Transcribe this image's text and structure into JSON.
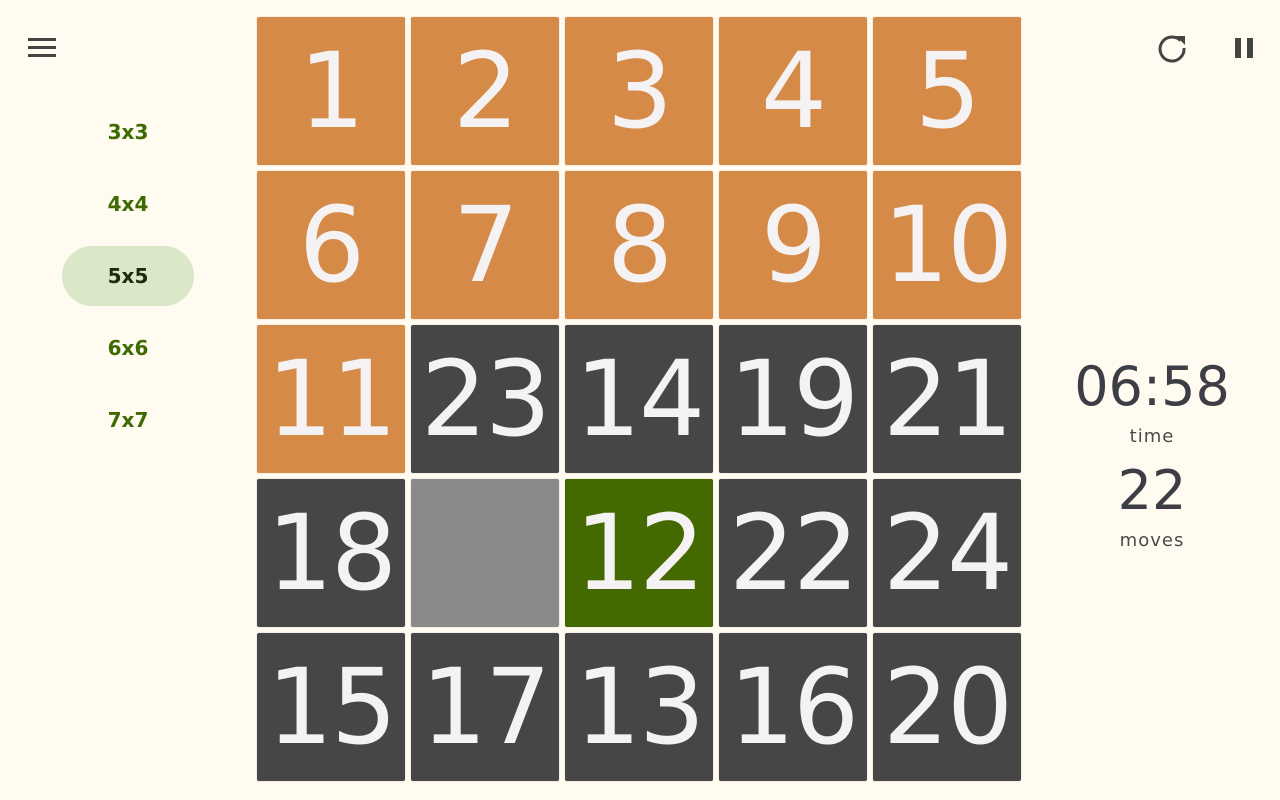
{
  "header": {
    "menu_icon": "menu-icon",
    "restart_icon": "restart-icon",
    "pause_icon": "pause-icon"
  },
  "sizes": [
    {
      "label": "3x3",
      "selected": false
    },
    {
      "label": "4x4",
      "selected": false
    },
    {
      "label": "5x5",
      "selected": true
    },
    {
      "label": "6x6",
      "selected": false
    },
    {
      "label": "7x7",
      "selected": false
    }
  ],
  "board": {
    "size": 5,
    "tiles": [
      "1",
      "2",
      "3",
      "4",
      "5",
      "6",
      "7",
      "8",
      "9",
      "10",
      "11",
      "23",
      "14",
      "19",
      "21",
      "18",
      "",
      "12",
      "22",
      "24",
      "15",
      "17",
      "13",
      "16",
      "20"
    ],
    "states": [
      "solved",
      "solved",
      "solved",
      "solved",
      "solved",
      "solved",
      "solved",
      "solved",
      "solved",
      "solved",
      "solved",
      "unsolved",
      "unsolved",
      "unsolved",
      "unsolved",
      "unsolved",
      "empty",
      "highlight",
      "unsolved",
      "unsolved",
      "unsolved",
      "unsolved",
      "unsolved",
      "unsolved",
      "unsolved"
    ]
  },
  "stats": {
    "time_value": "06:58",
    "time_label": "time",
    "moves_value": "22",
    "moves_label": "moves"
  },
  "colors": {
    "background": "#fffbf0",
    "solved_tile": "#d68a48",
    "unsolved_tile": "#464646",
    "highlight_tile": "#436900",
    "empty_tile": "#8a8a8a",
    "accent": "#3d6b00"
  }
}
